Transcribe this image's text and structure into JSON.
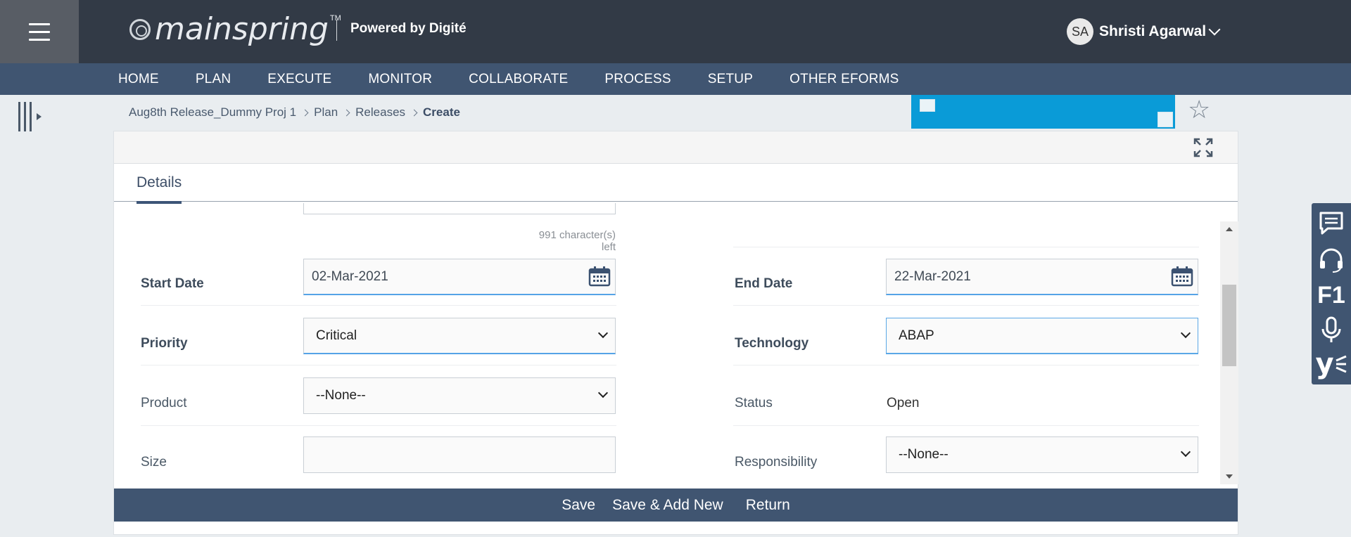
{
  "header": {
    "logo_text": "mainspring",
    "trademark": "TM",
    "powered_by": "Powered by Digité",
    "user": {
      "initials": "SA",
      "name": "Shristi Agarwal"
    }
  },
  "nav": {
    "items": [
      {
        "label": "HOME"
      },
      {
        "label": "PLAN"
      },
      {
        "label": "EXECUTE"
      },
      {
        "label": "MONITOR"
      },
      {
        "label": "COLLABORATE"
      },
      {
        "label": "PROCESS"
      },
      {
        "label": "SETUP"
      },
      {
        "label": "OTHER EFORMS"
      }
    ]
  },
  "breadcrumb": {
    "items": [
      {
        "label": "Aug8th Release_Dummy Proj 1"
      },
      {
        "label": "Plan"
      },
      {
        "label": "Releases"
      }
    ],
    "current": "Create"
  },
  "tabs": {
    "active": "Details"
  },
  "form": {
    "chars_left": "991 character(s) left",
    "start_date": {
      "label": "Start Date",
      "value": "02-Mar-2021"
    },
    "end_date": {
      "label": "End Date",
      "value": "22-Mar-2021"
    },
    "priority": {
      "label": "Priority",
      "value": "Critical"
    },
    "technology": {
      "label": "Technology",
      "value": "ABAP"
    },
    "product": {
      "label": "Product",
      "value": "--None--"
    },
    "status": {
      "label": "Status",
      "value": "Open"
    },
    "size": {
      "label": "Size",
      "value": ""
    },
    "responsibility": {
      "label": "Responsibility",
      "value": "--None--"
    }
  },
  "actions": {
    "save": "Save",
    "save_add_new": "Save & Add New",
    "return": "Return"
  },
  "rail": {
    "f1": "F1",
    "y": "y"
  },
  "colors": {
    "header_bg": "#323a46",
    "nav_bg": "#405571",
    "banner_bg": "#0a9bd7",
    "focus_blue": "#55a3e6"
  }
}
